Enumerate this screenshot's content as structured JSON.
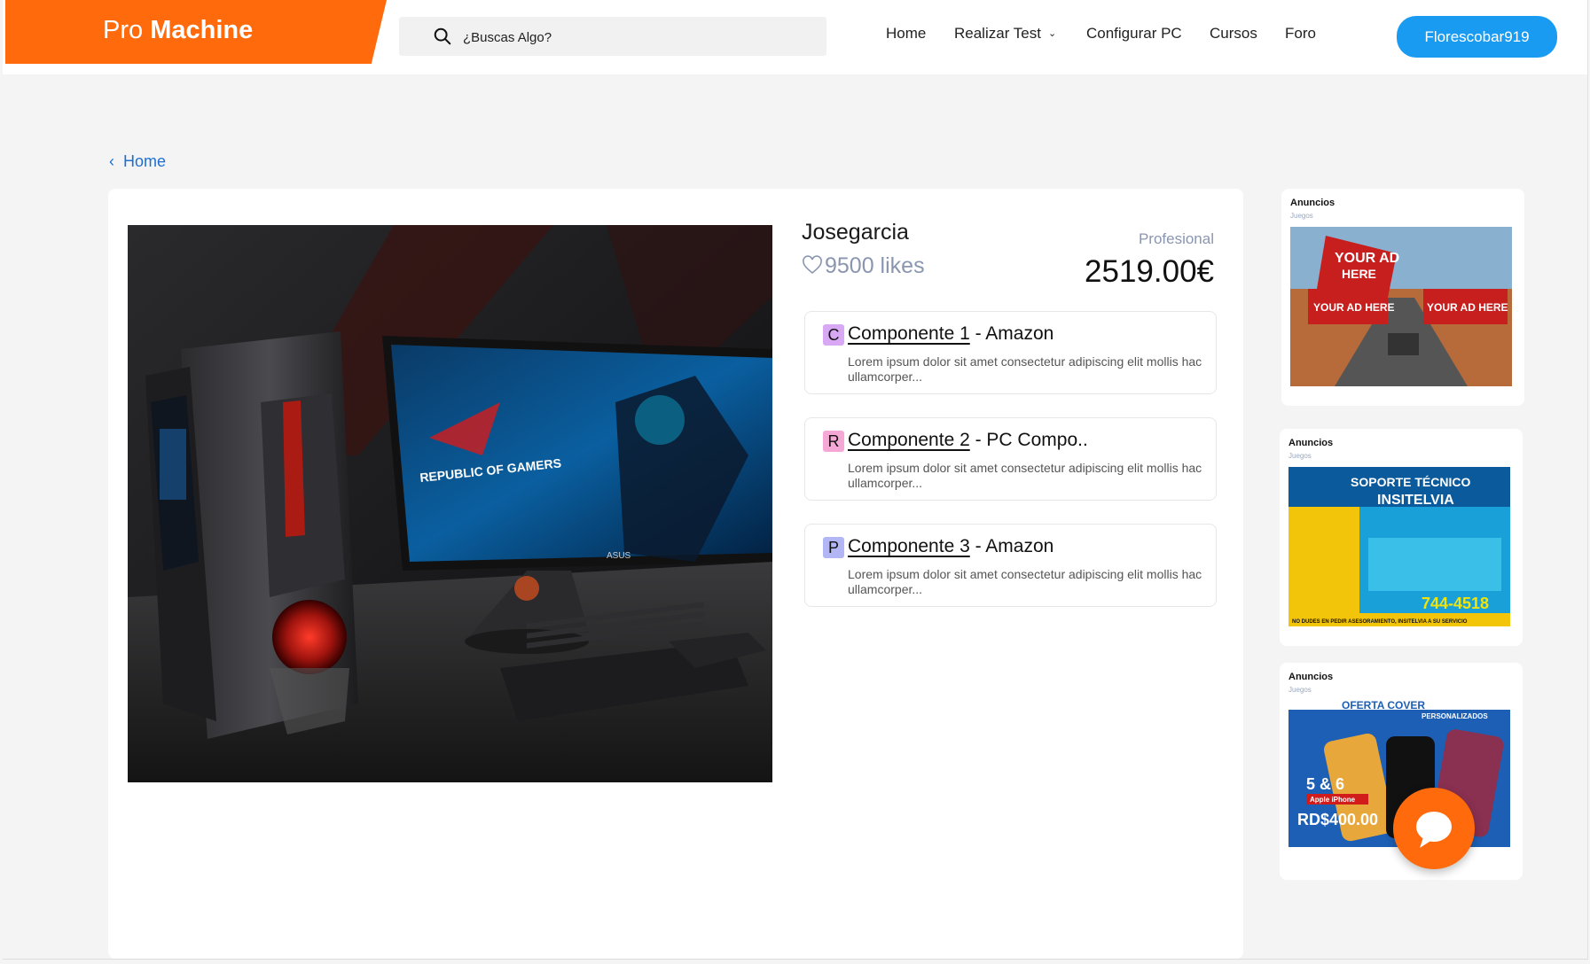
{
  "header": {
    "logo_light": "Pro",
    "logo_bold": "Machine",
    "search_placeholder": "¿Buscas Algo?",
    "nav": {
      "home": "Home",
      "test": "Realizar Test",
      "config": "Configurar PC",
      "courses": "Cursos",
      "forum": "Foro"
    },
    "user_button": "Florescobar919"
  },
  "breadcrumb": {
    "label": "Home"
  },
  "product": {
    "owner": "Josegarcia",
    "likes": "9500 likes",
    "level": "Profesional",
    "price": "2519.00€",
    "hero_text": "REPUBLIC OF GAMERS",
    "hero_brand": "ASUS",
    "components": [
      {
        "badge": "C",
        "badge_color": "#d9a8f5",
        "name": "Componente 1",
        "store": " - Amazon",
        "desc": "Lorem ipsum dolor sit amet consectetur adipiscing elit mollis hac ullamcorper..."
      },
      {
        "badge": "R",
        "badge_color": "#f5a8d6",
        "name": "Componente 2",
        "store": " - PC Compo..",
        "desc": "Lorem ipsum dolor sit amet consectetur adipiscing elit mollis hac ullamcorper..."
      },
      {
        "badge": "P",
        "badge_color": "#b3b6f5",
        "name": "Componente 3",
        "store": " - Amazon",
        "desc": "Lorem ipsum dolor sit amet consectetur adipiscing elit mollis hac ullamcorper..."
      }
    ]
  },
  "ads": [
    {
      "title": "Anuncios",
      "subtitle": "Juegos",
      "img_line1": "YOUR AD",
      "img_line2": "HERE",
      "img_line3": "YOUR AD HERE",
      "img_line4": "YOUR AD HERE"
    },
    {
      "title": "Anuncios",
      "subtitle": "Juegos",
      "img_line1": "SOPORTE TÉCNICO",
      "img_line2": "INSITELVIA",
      "img_line3": "744-4518",
      "img_line4": "NO DUDES EN PEDIR ASESORAMIENTO, INSITELVIA A SU SERVICIO"
    },
    {
      "title": "Anuncios",
      "subtitle": "Juegos",
      "img_line1": "OFERTA COVER",
      "img_line2": "PERSONALIZADOS",
      "img_line3": "5 & 6",
      "img_line4": "Apple iPhone",
      "img_line5": "RD$400.00"
    }
  ],
  "colors": {
    "brand": "#ff6a0c",
    "accent": "#1a9bf2",
    "link": "#1d6fd1",
    "muted": "#8a96b0"
  }
}
